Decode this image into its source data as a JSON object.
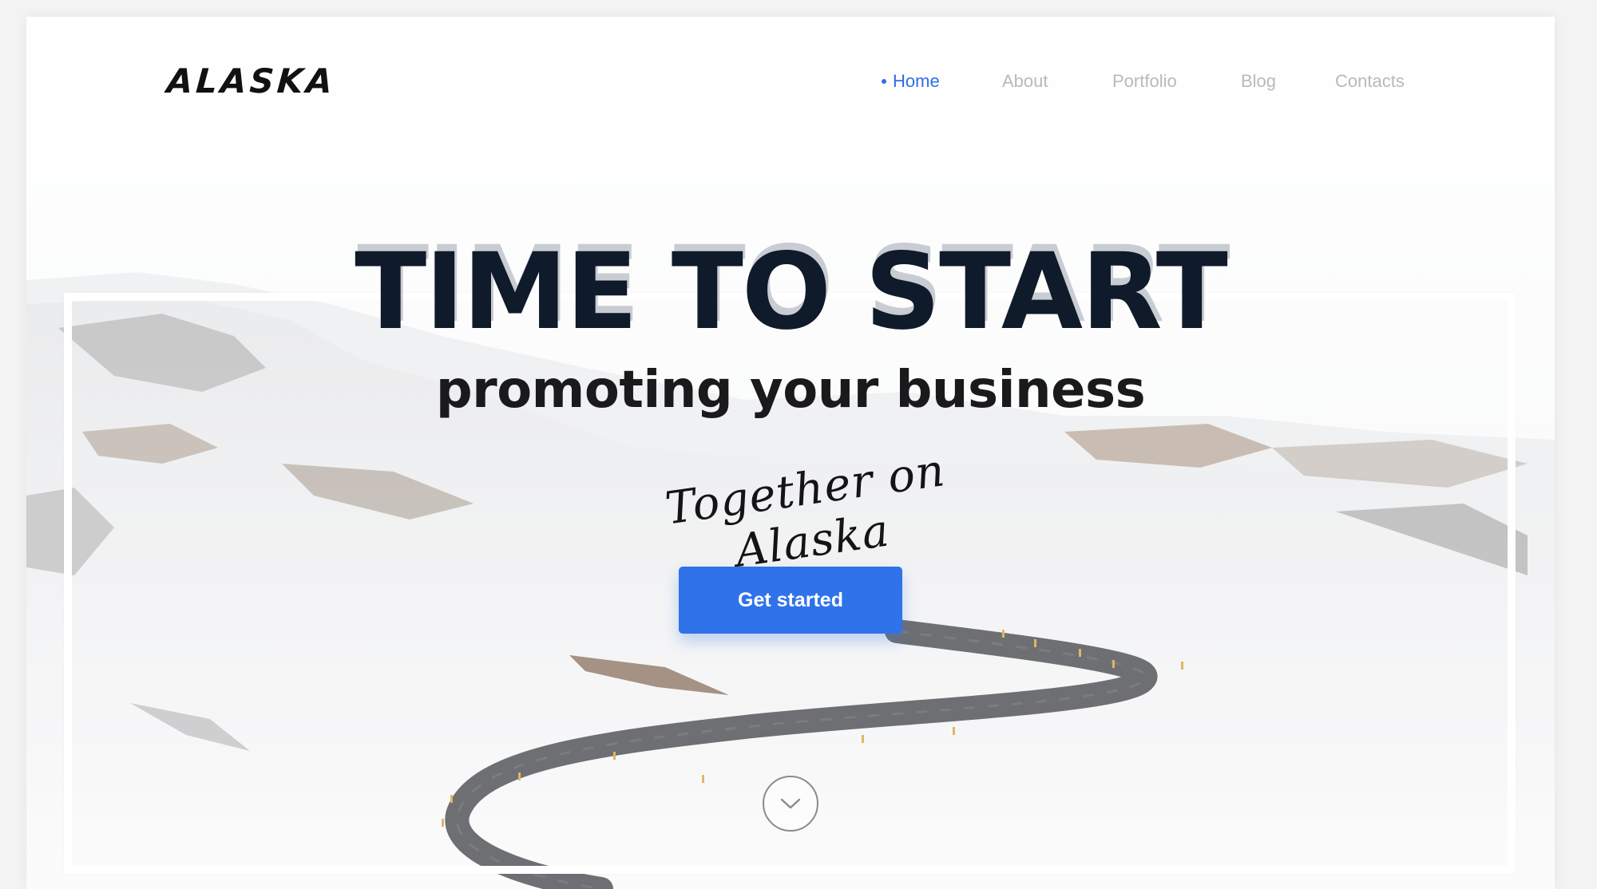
{
  "brand": {
    "logo_text": "ALASKA"
  },
  "nav": {
    "items": [
      {
        "label": "Home",
        "active": true
      },
      {
        "label": "About",
        "active": false
      },
      {
        "label": "Portfolio",
        "active": false
      },
      {
        "label": "Blog",
        "active": false
      },
      {
        "label": "Contacts",
        "active": false
      }
    ]
  },
  "hero": {
    "title": "TIME TO START",
    "subtitle": "promoting your business",
    "tagline": "Together on Alaska",
    "cta_label": "Get started"
  },
  "colors": {
    "accent": "#2f72ea",
    "nav_active": "#2f6ee8",
    "nav_inactive": "#b9b9bd",
    "title": "#0f1a2a"
  },
  "icons": {
    "scroll": "chevron-down-icon"
  }
}
